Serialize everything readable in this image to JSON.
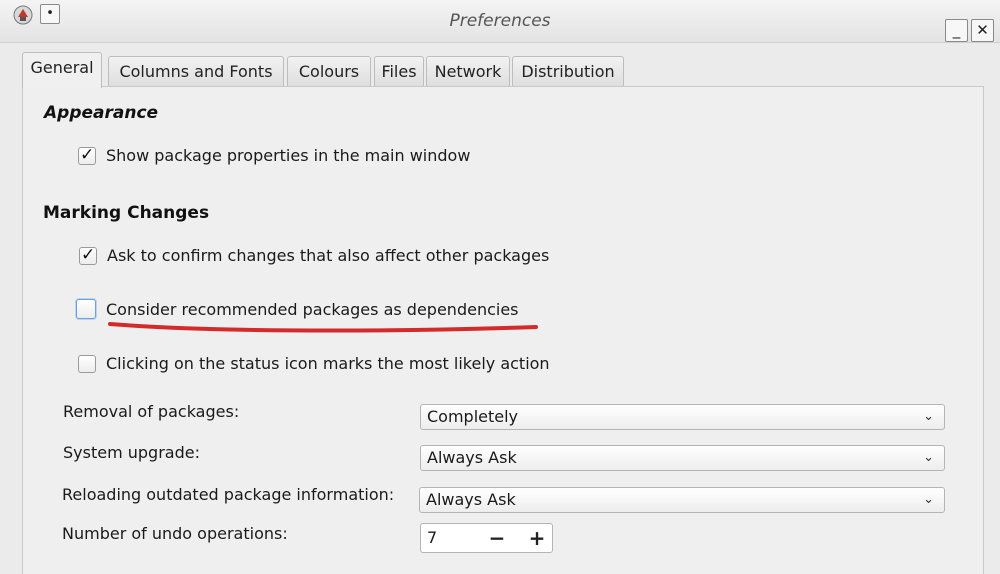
{
  "window": {
    "title": "Preferences",
    "sys_button_glyph": "•",
    "minimize_glyph": "_",
    "close_glyph": "✕"
  },
  "tabs": [
    {
      "label": "General",
      "active": true
    },
    {
      "label": "Columns and Fonts"
    },
    {
      "label": "Colours"
    },
    {
      "label": "Files"
    },
    {
      "label": "Network"
    },
    {
      "label": "Distribution"
    }
  ],
  "appearance": {
    "title": "Appearance",
    "options": [
      {
        "label": "Show package properties in the main window",
        "checked": true
      }
    ]
  },
  "marking": {
    "title": "Marking Changes",
    "options": [
      {
        "label": "Ask to confirm changes that also affect other packages",
        "checked": true
      },
      {
        "label": "Consider recommended packages as dependencies",
        "checked": false
      },
      {
        "label": "Clicking on the status icon marks the most likely action",
        "checked": false
      }
    ]
  },
  "settings": {
    "removal": {
      "label": "Removal of packages:",
      "value": "Completely"
    },
    "upgrade": {
      "label": "System upgrade:",
      "value": "Always Ask"
    },
    "reloading": {
      "label": "Reloading outdated package information:",
      "value": "Always Ask"
    },
    "undo": {
      "label": "Number of undo operations:",
      "value": "7",
      "minus": "−",
      "plus": "+"
    }
  },
  "glyphs": {
    "check": "✓",
    "chevron": "⌄"
  },
  "colors": {
    "annotation": "#d42a2a"
  }
}
